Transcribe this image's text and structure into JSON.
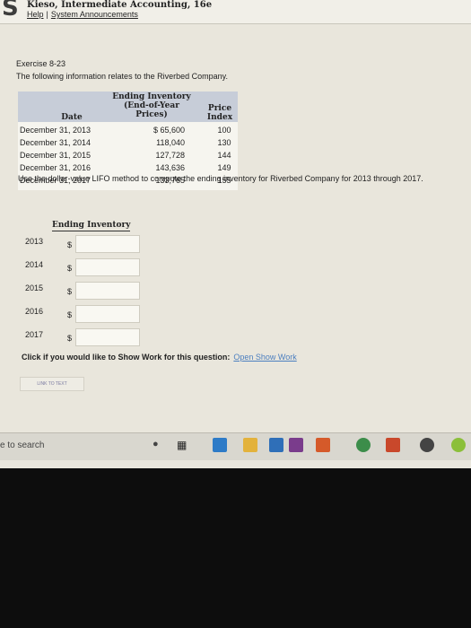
{
  "header": {
    "book_title": "Kieso, Intermediate Accounting, 16e",
    "help_link": "Help",
    "separator": "|",
    "announcements_link": "System Announcements"
  },
  "exercise": {
    "title": "Exercise 8-23",
    "description": "The following information relates to the Riverbed Company."
  },
  "table": {
    "col_date": "Date",
    "col_inventory": "Ending Inventory (End-of-Year Prices)",
    "col_index": "Price Index",
    "rows": [
      {
        "date": "December 31, 2013",
        "inventory": "$ 65,600",
        "index": "100"
      },
      {
        "date": "December 31, 2014",
        "inventory": "118,040",
        "index": "130"
      },
      {
        "date": "December 31, 2015",
        "inventory": "127,728",
        "index": "144"
      },
      {
        "date": "December 31, 2016",
        "inventory": "143,636",
        "index": "149"
      },
      {
        "date": "December 31, 2017",
        "inventory": "133,765",
        "index": "155"
      }
    ]
  },
  "instruction": "Use the dollar-value LIFO method to compute the ending inventory for Riverbed Company for 2013 through 2017.",
  "answer_header": "Ending Inventory",
  "currency": "$",
  "answers": [
    {
      "year": "2013",
      "value": ""
    },
    {
      "year": "2014",
      "value": ""
    },
    {
      "year": "2015",
      "value": ""
    },
    {
      "year": "2016",
      "value": ""
    },
    {
      "year": "2017",
      "value": ""
    }
  ],
  "show_work": {
    "prompt": "Click if you would like to Show Work for this question:",
    "link": "Open Show Work"
  },
  "link_to_text": "LINK TO TEXT",
  "taskbar": {
    "search_text": "e to search",
    "icons": [
      "mic-icon",
      "task-view-icon",
      "edge-icon",
      "file-explorer-icon",
      "store-icon",
      "onenote-icon",
      "folder-icon",
      "chrome-icon",
      "powerpoint-icon",
      "app-icon",
      "app-icon-2"
    ]
  },
  "colors": {
    "table_header": "#c7cdd8",
    "link": "#4c7fbf",
    "page_bg": "#e9e6dc"
  }
}
